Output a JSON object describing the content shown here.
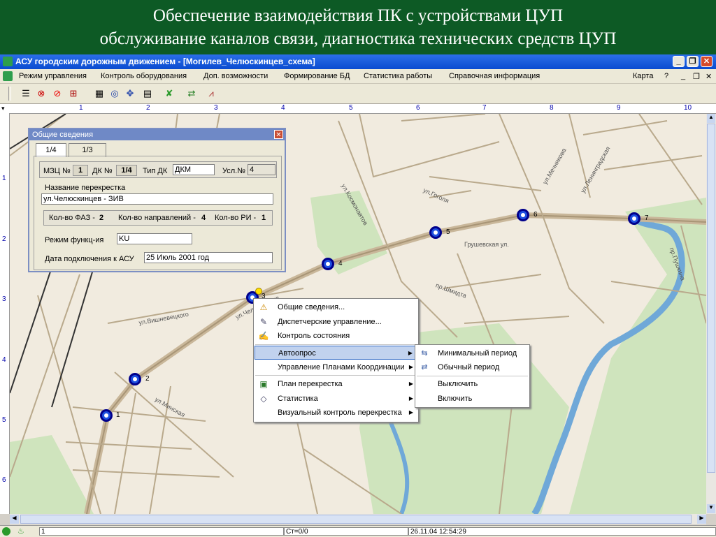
{
  "banner": {
    "line1": "Обеспечение взаимодействия ПК с устройствами ЦУП",
    "line2": "обслуживание каналов связи, диагностика технических средств ЦУП"
  },
  "window": {
    "title": "АСУ городским дорожным движением - [Могилев_Челюскинцев_схема]"
  },
  "menubar": {
    "items": [
      "Режим управления",
      "Контроль оборудования",
      "Доп. возможности",
      "Формирование БД",
      "Статистика работы",
      "Справочная информация"
    ],
    "right_label": "Карта",
    "help": "?"
  },
  "toolbar": {
    "icons": [
      "list-icon",
      "stop-icon",
      "forbid-icon",
      "grid-icon",
      "checker-icon",
      "target-icon",
      "cross-arrows-icon",
      "document-icon",
      "green-x-icon",
      "arrows-icon",
      "triangle-icon"
    ]
  },
  "ruler": {
    "h_ticks": [
      "1",
      "2",
      "3",
      "4",
      "5",
      "6",
      "7",
      "8",
      "9",
      "10"
    ],
    "v_ticks": [
      "1",
      "2",
      "3",
      "4",
      "5",
      "6"
    ]
  },
  "map": {
    "crossings": [
      "1",
      "2",
      "3",
      "4",
      "5",
      "6",
      "7"
    ],
    "streets": [
      "ул.Вишневецкого",
      "ул.Космонавтов",
      "пр.Шмидта",
      "Грушевская ул.",
      "ул.Гоголя",
      "пр.Пушкина",
      "ул.Челюскинцев",
      "ул.Мечникова",
      "ул.Ленинградская",
      "ул.Минская"
    ]
  },
  "dialog": {
    "title": "Общие сведения",
    "tabs": [
      "1/4",
      "1/3"
    ],
    "mzc_label": "МЗЦ №",
    "mzc_value": "1",
    "dk_label": "ДК №",
    "dk_value": "1/4",
    "type_label": "Тип ДК",
    "type_value": "ДКМ",
    "usl_label": "Усл.№",
    "usl_value": "4",
    "name_label": "Название перекрестка",
    "name_value": "ул.Челюскинцев - ЗИВ",
    "faz_label": "Кол-во ФАЗ -",
    "faz_value": "2",
    "dir_label": "Кол-во направлений -",
    "dir_value": "4",
    "ri_label": "Кол-во РИ -",
    "ri_value": "1",
    "mode_label": "Режим функц-ия",
    "mode_value": "KU",
    "date_label": "Дата подключения к АСУ",
    "date_value": "25 Июль 2001 год"
  },
  "context_menu": {
    "items": [
      "Общие сведения...",
      "Диспетчерские управление...",
      "Контроль состояния",
      "Автоопрос",
      "Управление Планами Координации",
      "План перекрестка",
      "Статистика",
      "Визуальный контроль перекрестка"
    ]
  },
  "submenu": {
    "items": [
      "Минимальный период",
      "Обычный период",
      "Выключить",
      "Включить"
    ]
  },
  "status": {
    "field1": "1",
    "field2": "Ст=0/0",
    "datetime": "26.11.04 12:54:29"
  }
}
